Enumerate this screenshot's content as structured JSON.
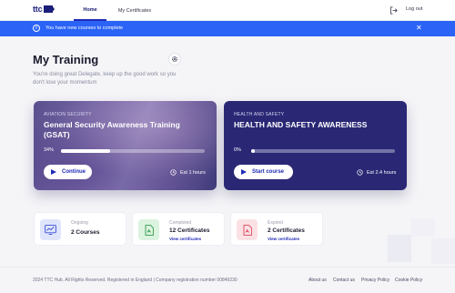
{
  "header": {
    "logo": "ttc",
    "nav": [
      {
        "label": "Home"
      },
      {
        "label": "My Certificates"
      }
    ],
    "logout_label": "Log out"
  },
  "banner": {
    "message": "You have new courses to complete",
    "info_icon": "info-icon",
    "close_icon": "close-icon"
  },
  "main": {
    "title": "My Training",
    "subtitle": "You're doing great Delegate, keep up the good work so you don't lose your momentum"
  },
  "courses": [
    {
      "category": "AVIATION SECURITY",
      "title": "General Security Awareness Training (GSAT)",
      "progress_label": "34%",
      "progress": 0.34,
      "button_label": "Continue",
      "duration": "Est 1 hours"
    },
    {
      "category": "HEALTH AND SAFETY",
      "title": "HEALTH AND SAFETY AWARENESS",
      "progress_label": "0%",
      "progress": 0.0,
      "button_label": "Start course",
      "duration": "Est 2.4 hours"
    }
  ],
  "stats": [
    {
      "label": "Ongoing",
      "value": "2 Courses",
      "link": "",
      "icon": "chart-icon",
      "color": "#dfe5fb"
    },
    {
      "label": "Completed",
      "value": "12 Certificates",
      "link": "View certificates",
      "icon": "certificate-icon",
      "color": "#dcf3df"
    },
    {
      "label": "Expired",
      "value": "2 Certificates",
      "link": "View certificates",
      "icon": "expired-certificate-icon",
      "color": "#fbe1e4"
    }
  ],
  "footer": {
    "copyright": "2024 TTC Hub. All Rights Reserved. Registered in England | Company registration number 00849230",
    "links": [
      "About us",
      "Contact us",
      "Privacy Policy",
      "Cookie Policy"
    ]
  },
  "colors": {
    "primary": "#1f2ab5",
    "banner": "#2a63f6",
    "card_dark": "#2a2875"
  }
}
